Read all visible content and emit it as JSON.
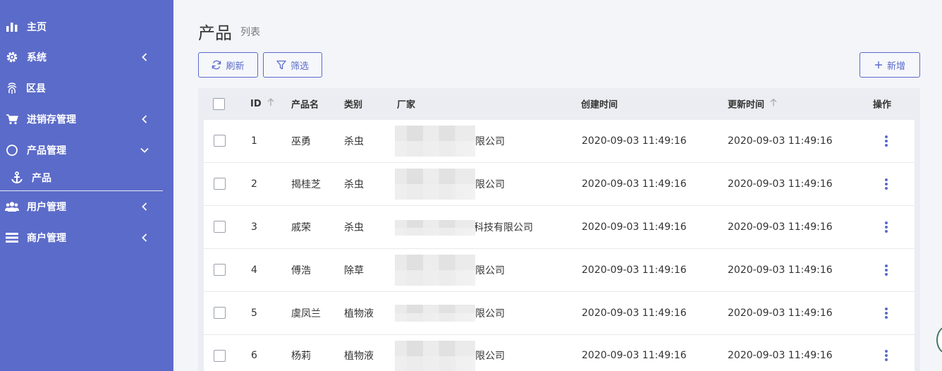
{
  "sidebar": {
    "items": [
      {
        "label": "主页",
        "icon": "bar-chart-icon"
      },
      {
        "label": "系统",
        "icon": "gear-icon",
        "chevron": "left"
      },
      {
        "label": "区县",
        "icon": "fingerprint-icon"
      },
      {
        "label": "进销存管理",
        "icon": "cart-icon",
        "chevron": "left"
      },
      {
        "label": "产品管理",
        "icon": "circle-icon",
        "chevron": "down"
      },
      {
        "label": "产品",
        "icon": "anchor-icon",
        "sub": true
      },
      {
        "label": "用户管理",
        "icon": "users-icon",
        "chevron": "left"
      },
      {
        "label": "商户管理",
        "icon": "list-icon",
        "chevron": "left"
      }
    ],
    "bg_color": "#5b6bc9"
  },
  "header": {
    "title": "产品",
    "subtitle": "列表"
  },
  "toolbar": {
    "refresh_label": "刷新",
    "filter_label": "筛选",
    "add_label": "新增",
    "accent_color": "#5b6bc9"
  },
  "table": {
    "columns": [
      "ID",
      "产品名",
      "类别",
      "厂家",
      "创建时间",
      "更新时间",
      "操作"
    ],
    "rows": [
      {
        "id": "1",
        "name": "巫勇",
        "category": "杀虫",
        "vendor": "限公司",
        "created": "2020-09-03 11:49:16",
        "updated": "2020-09-03 11:49:16"
      },
      {
        "id": "2",
        "name": "揭桂芝",
        "category": "杀虫",
        "vendor": "限公司",
        "created": "2020-09-03 11:49:16",
        "updated": "2020-09-03 11:49:16"
      },
      {
        "id": "3",
        "name": "戚荣",
        "category": "杀虫",
        "vendor": "科技有限公司",
        "created": "2020-09-03 11:49:16",
        "updated": "2020-09-03 11:49:16"
      },
      {
        "id": "4",
        "name": "傅浩",
        "category": "除草",
        "vendor": "限公司",
        "created": "2020-09-03 11:49:16",
        "updated": "2020-09-03 11:49:16"
      },
      {
        "id": "5",
        "name": "虞凤兰",
        "category": "植物液",
        "vendor": "限公司",
        "created": "2020-09-03 11:49:16",
        "updated": "2020-09-03 11:49:16"
      },
      {
        "id": "6",
        "name": "杨莉",
        "category": "植物液",
        "vendor": "限公司",
        "created": "2020-09-03 11:49:16",
        "updated": "2020-09-03 11:49:16"
      }
    ]
  }
}
